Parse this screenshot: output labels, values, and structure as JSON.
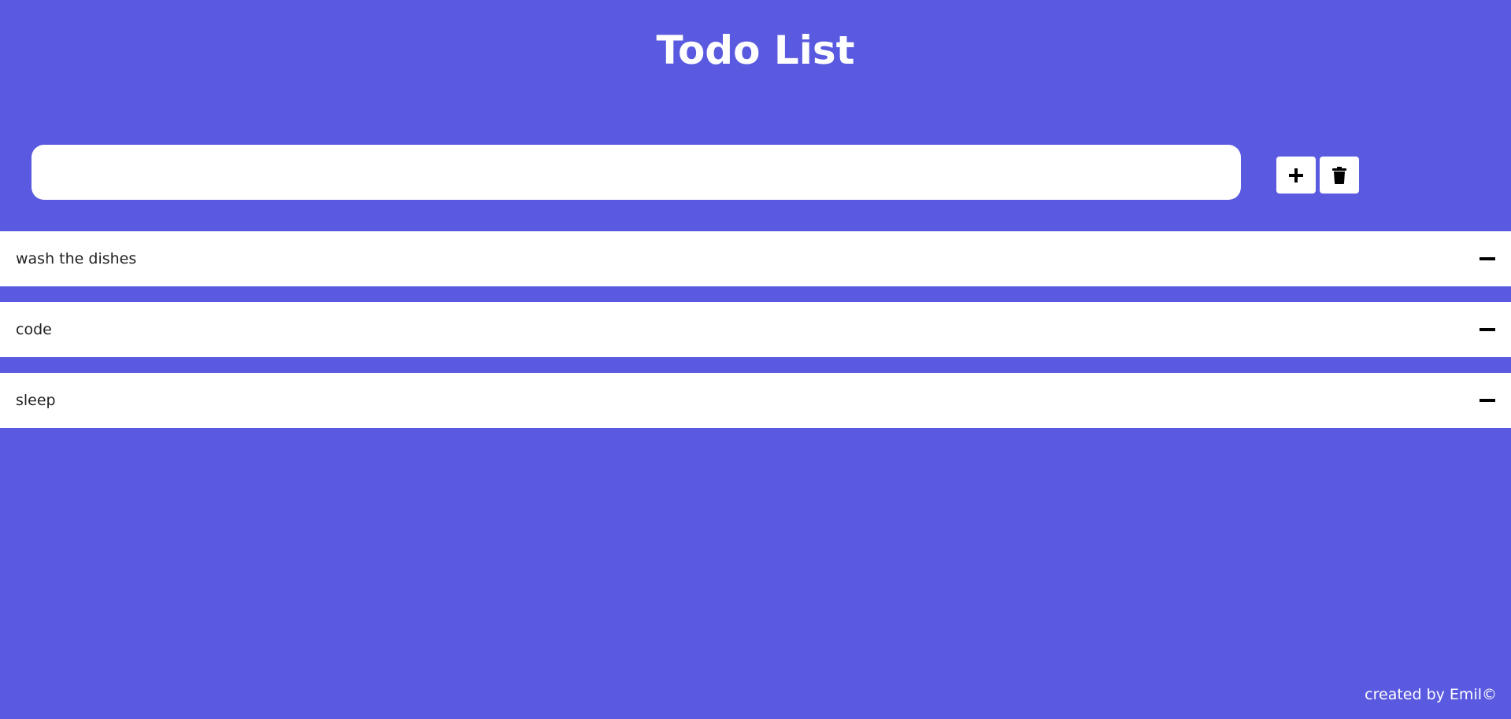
{
  "header": {
    "title": "Todo List"
  },
  "form": {
    "input_value": "",
    "input_placeholder": "",
    "add_icon": "plus-icon",
    "clear_icon": "trash-icon"
  },
  "todos": [
    {
      "text": "wash the dishes",
      "remove_icon": "minus-icon"
    },
    {
      "text": "code",
      "remove_icon": "minus-icon"
    },
    {
      "text": "sleep",
      "remove_icon": "minus-icon"
    }
  ],
  "footer": {
    "credit": "created by Emil©"
  },
  "colors": {
    "background": "#5a5ae0",
    "surface": "#ffffff",
    "text": "#222222",
    "icon": "#000000"
  }
}
